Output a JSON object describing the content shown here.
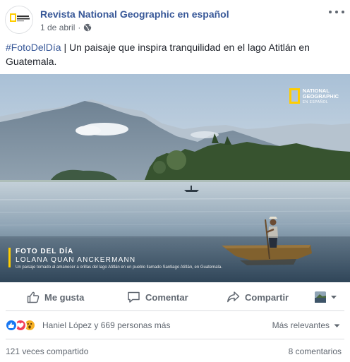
{
  "post": {
    "page_name": "Revista National Geographic en español",
    "date": "1 de abril",
    "date_separator": "·",
    "hashtag": "#FotoDelDía",
    "text": " | Un paisaje que inspira tranquilidad en el lago Atitlán en Guatemala."
  },
  "photo": {
    "caption_title": "FOTO DEL DÍA",
    "caption_author": "LOLANA QUAN ANCKERMANN",
    "caption_description": "Un paisaje tomado al amanecer a orillas del lago Atitlán en un pueblo llamado Santiago Atitlán, en Guatemala.",
    "logo_line1": "NATIONAL",
    "logo_line2": "GEOGRAPHIC",
    "logo_line3": "EN ESPAÑOL"
  },
  "actions": {
    "like_label": "Me gusta",
    "comment_label": "Comentar",
    "share_label": "Compartir"
  },
  "reactions": {
    "summary": "Haniel López y 669 personas más",
    "sort_label": "Más relevantes",
    "icons": [
      "like-icon",
      "love-icon",
      "wow-icon"
    ]
  },
  "stats": {
    "shares": "121 veces compartido",
    "comments": "8 comentarios"
  },
  "colors": {
    "link": "#385898",
    "secondary_text": "#606770",
    "ng_yellow": "#ffcd00",
    "like_blue": "#1877f2",
    "love_red": "#f33e58",
    "wow_yellow": "#f7b125"
  }
}
